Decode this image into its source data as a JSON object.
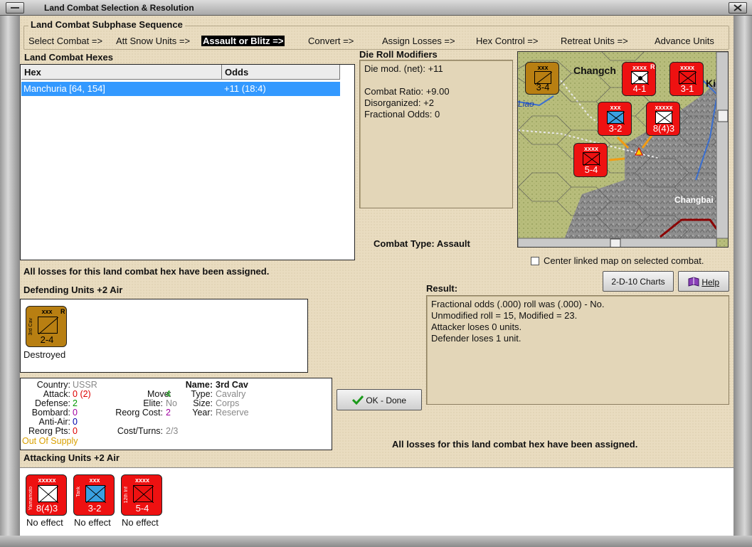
{
  "window": {
    "title": "Land Combat Selection & Resolution"
  },
  "sequence": {
    "title": "Land Combat Subphase Sequence",
    "steps": [
      "Select Combat =>",
      "Att Snow Units =>",
      "Assault or Blitz =>",
      "Convert =>",
      "Assign Losses =>",
      "Hex Control =>",
      "Retreat Units =>",
      "Advance Units"
    ],
    "active_index": 2
  },
  "hexes": {
    "label": "Land Combat Hexes",
    "columns": [
      "Hex",
      "Odds"
    ],
    "rows": [
      {
        "hex": "Manchuria [64, 154]",
        "odds": "+11 (18:4)"
      }
    ]
  },
  "die_roll": {
    "label": "Die Roll Modifiers",
    "lines": [
      "Die mod. (net): +11",
      "",
      "Combat Ratio: +9.00",
      "Disorganized: +2",
      "Fractional Odds: 0"
    ]
  },
  "map": {
    "labels": [
      "Changch",
      "Ki",
      "Liao",
      "Changbai"
    ],
    "counters": [
      {
        "size": "xxx",
        "strength": "3-4",
        "color": "#b87f12"
      },
      {
        "size": "xxxx",
        "strength": "4-1",
        "color": "#ee1111",
        "badge": "R"
      },
      {
        "size": "xxxx",
        "strength": "3-1",
        "color": "#ee1111"
      },
      {
        "size": "xxx",
        "strength": "3-2",
        "color": "#ee1111"
      },
      {
        "size": "xxxxx",
        "strength": "8(4)3",
        "color": "#ee1111"
      },
      {
        "size": "xxxx",
        "strength": "5-4",
        "color": "#ee1111"
      }
    ],
    "center_label": "Center linked map on selected combat.",
    "center_checked": false
  },
  "combat_type": {
    "label": "Combat Type:",
    "value": "Assault"
  },
  "losses_message": "All losses for this land combat hex have been assigned.",
  "defending": {
    "label": "Defending Units +2 Air",
    "units": [
      {
        "name": "3rd Cav",
        "size": "xxx",
        "strength": "2-4",
        "badge": "R",
        "status": "Destroyed",
        "color": "#b87f12"
      }
    ]
  },
  "buttons": {
    "charts": "2-D-10 Charts",
    "help": "Help",
    "ok": "OK - Done"
  },
  "result": {
    "label": "Result:",
    "lines": [
      "Fractional odds (.000) roll was (.000)  - No.",
      "Unmodified roll = 15, Modified = 23.",
      "Attacker loses 0 units.",
      "Defender loses 1 unit."
    ]
  },
  "info": {
    "country_k": "Country:",
    "country": "USSR",
    "attack_k": "Attack:",
    "attack": "0",
    "attack_paren": "(2)",
    "defense_k": "Defense:",
    "defense": "2",
    "bombard_k": "Bombard:",
    "bombard": "0",
    "antiair_k": "Anti-Air:",
    "antiair": "0",
    "reorgpts_k": "Reorg Pts:",
    "reorgpts": "0",
    "supply": "Out Of Supply",
    "move_k": "Move:",
    "move": "4",
    "elite_k": "Elite:",
    "elite": "No",
    "reorgcost_k": "Reorg Cost:",
    "reorgcost": "2",
    "costturns_k": "Cost/Turns:",
    "costturns": "2/3",
    "name_k": "Name:",
    "name": "3rd Cav",
    "type_k": "Type:",
    "type": "Cavalry",
    "size_k": "Size:",
    "size": "Corps",
    "year_k": "Year:",
    "year": "Reserve"
  },
  "attacking": {
    "label": "Attacking Units +2 Air",
    "units": [
      {
        "name": "Yamamoto",
        "size": "xxxxx",
        "strength": "8(4)3",
        "status": "No effect",
        "color": "#ee1111"
      },
      {
        "name": "Tank",
        "size": "xxx",
        "strength": "3-2",
        "status": "No effect",
        "color": "#ee1111"
      },
      {
        "name": "12th Inf",
        "size": "xxxx",
        "strength": "5-4",
        "status": "No effect",
        "color": "#ee1111"
      }
    ]
  },
  "colors": {
    "accent": "#3399ff",
    "panel": "#e9dcc0",
    "japan_red": "#ee1111",
    "ussr_brown": "#b87f12"
  }
}
